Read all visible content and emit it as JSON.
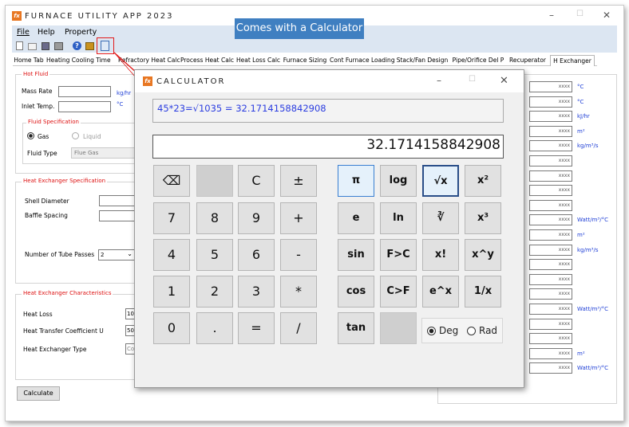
{
  "app": {
    "title": "FURNACE UTILITY APP 2023",
    "logo": "fx",
    "minimize": "–",
    "maximize": "☐",
    "close": "✕"
  },
  "menu": [
    "File",
    "Help",
    "Property"
  ],
  "toolbar": {
    "icons": [
      "new-file-icon",
      "open-folder-icon",
      "save-icon",
      "print-icon",
      "help-icon",
      "settings-icon",
      "calculator-icon"
    ]
  },
  "tabs": [
    "Home Tab",
    "Heating Cooling Time",
    "Refractory Heat Calc",
    "Process Heat Calc",
    "Heat Loss Calc",
    "Furnace Sizing",
    "Cont Furnace Loading",
    "Stack/Fan Design",
    "Pipe/Orifice Del P",
    "Recuperator",
    "H Exchanger"
  ],
  "hot_fluid": {
    "title": "Hot Fluid",
    "mass_rate_label": "Mass Rate",
    "mass_rate_unit": "kg/hr",
    "inlet_temp_label": "Inlet Temp.",
    "inlet_temp_unit": "°C"
  },
  "fluid_spec": {
    "title": "Fluid Specification",
    "gas_label": "Gas",
    "liquid_label": "Liquid",
    "fluid_type_label": "Fluid Type",
    "fluid_type_value": "Flue Gas"
  },
  "hx_spec": {
    "title": "Heat Exchanger Specification",
    "shell_diameter_label": "Shell Diameter",
    "baffle_spacing_label": "Baffle Spacing",
    "tube_passes_label": "Number of Tube Passes",
    "tube_passes_value": "2"
  },
  "hx_char": {
    "title": "Heat Exchanger Characteristics",
    "heat_loss_label": "Heat Loss",
    "heat_loss_value": "10",
    "htc_label": "Heat Transfer Coefficient U",
    "htc_value": "50",
    "hx_type_label": "Heat Exchanger Type",
    "hx_type_value": "Co"
  },
  "calculate_label": "Calculate",
  "results": {
    "placeholder": "xxxx",
    "units": {
      "r0": "°C",
      "r1": "°C",
      "r2": "kJ/hr",
      "r3": "m²",
      "r4": "kg/m³/s",
      "r9": "Watt/m³/°C",
      "r10": "m²",
      "r11": "kg/m³/s",
      "r15": "Watt/m³/°C",
      "r18": "m²",
      "r19": "Watt/m³/°C"
    }
  },
  "callout": "Comes with a Calculator",
  "calculator": {
    "title": "CALCULATOR",
    "expression": "45*23=√1035 = 32.1714158842908",
    "display": "32.1714158842908",
    "keys": {
      "backspace": "⌫",
      "clear": "C",
      "plusminus": "±",
      "seven": "7",
      "eight": "8",
      "nine": "9",
      "plus": "+",
      "four": "4",
      "five": "5",
      "six": "6",
      "minus": "-",
      "one": "1",
      "two": "2",
      "three": "3",
      "multiply": "*",
      "zero": "0",
      "dot": ".",
      "equals": "=",
      "divide": "/",
      "pi": "π",
      "log": "log",
      "sqrt": "√x",
      "square": "x²",
      "e": "e",
      "ln": "ln",
      "cuberoot": "∛",
      "cube": "x³",
      "sin": "sin",
      "f_to_c": "F>C",
      "factorial": "x!",
      "power": "x^y",
      "cos": "cos",
      "c_to_f": "C>F",
      "exp": "e^x",
      "reciprocal": "1/x",
      "tan": "tan"
    },
    "deg_label": "Deg",
    "rad_label": "Rad"
  }
}
